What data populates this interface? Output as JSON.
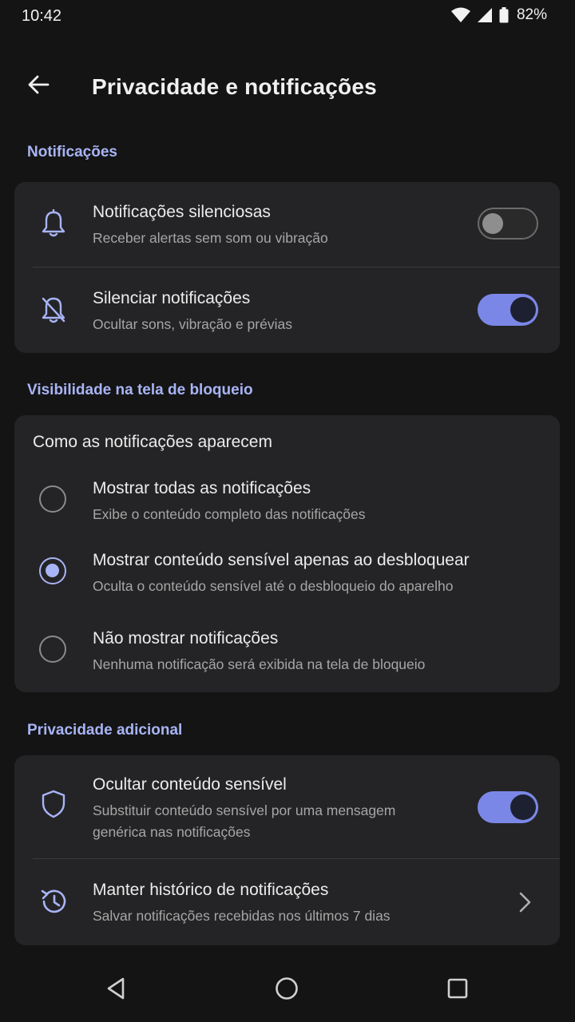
{
  "status_bar": {
    "time": "10:42",
    "battery": "82%"
  },
  "header": {
    "title": "Privacidade e notificações",
    "back_icon": "arrow-back-icon"
  },
  "sections": {
    "notifications": {
      "label": "Notificações",
      "items": [
        {
          "icon": "bell-icon",
          "title": "Notificações silenciosas",
          "subtitle": "Receber alertas sem som ou vibração",
          "toggle": false
        },
        {
          "icon": "bell-off-icon",
          "title": "Silenciar notificações",
          "subtitle": "Ocultar sons, vibração e prévias",
          "toggle": true
        }
      ]
    },
    "lockscreen": {
      "label": "Visibilidade na tela de bloqueio",
      "group_title": "Como as notificações aparecem",
      "options": [
        {
          "title": "Mostrar todas as notificações",
          "subtitle": "Exibe o conteúdo completo das notificações",
          "selected": false
        },
        {
          "title": "Mostrar conteúdo sensível apenas ao desbloquear",
          "subtitle": "Oculta o conteúdo sensível até o desbloqueio do aparelho",
          "selected": true
        },
        {
          "title": "Não mostrar notificações",
          "subtitle": "Nenhuma notificação será exibida na tela de bloqueio",
          "selected": false
        }
      ]
    },
    "privacy": {
      "label": "Privacidade adicional",
      "items": [
        {
          "icon": "shield-icon",
          "title": "Ocultar conteúdo sensível",
          "subtitle_line1": "Substituir conteúdo sensível por uma mensagem",
          "subtitle_line2": "genérica nas notificações",
          "toggle": true
        },
        {
          "icon": "history-icon",
          "title": "Manter histórico de notificações",
          "subtitle": "Salvar notificações recebidas nos últimos 7 dias",
          "action_icon": "chevron-right-icon"
        }
      ]
    }
  },
  "colors": {
    "accent": "#a8b4f5",
    "toggle_on": "#7b87e6",
    "card": "#242426",
    "background": "#141414"
  }
}
